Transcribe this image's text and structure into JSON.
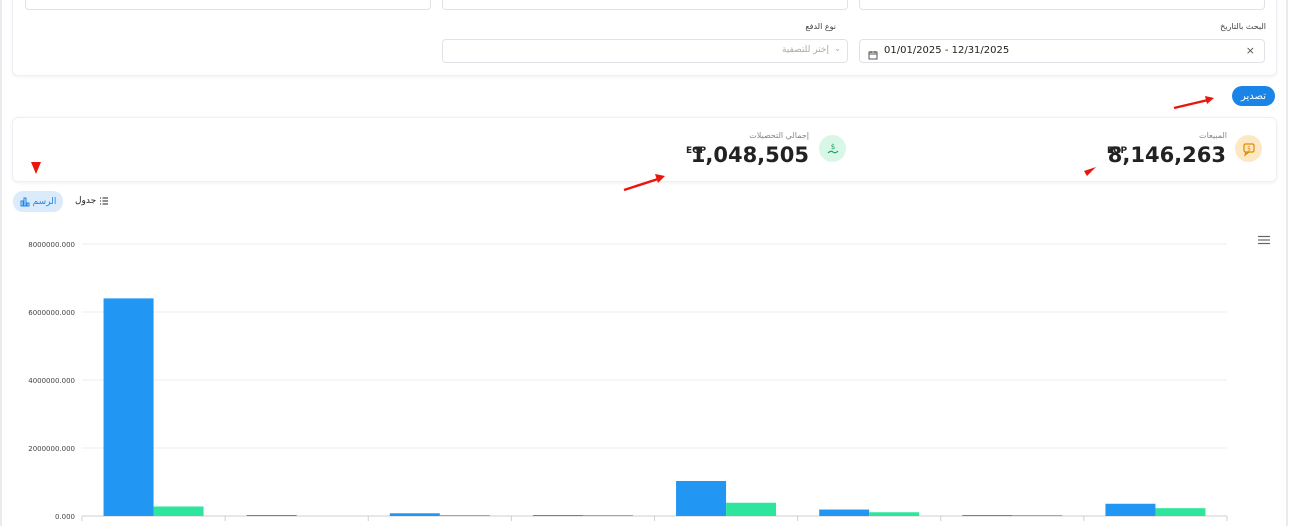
{
  "filters": {
    "date_label": "البحث بالتاريخ",
    "date_value": "01/01/2025 - 12/31/2025",
    "payment_label": "نوع الدفع",
    "payment_placeholder": "إختر للتصفية"
  },
  "export_label": "تصدير",
  "kpis": {
    "sales_label": "المبيعات",
    "sales_value": "8,146,263",
    "sales_currency": "EGP",
    "collections_label": "إجمالي التحصيلات",
    "collections_value": "1,048,505",
    "collections_currency": "EGP"
  },
  "view_toggle": {
    "chart_label": "الرسم",
    "table_label": "جدول"
  },
  "colors": {
    "series1": "#2196f3",
    "series2": "#2ee59d",
    "accent": "#1b84e7",
    "annotation": "#e8160c"
  },
  "chart_data": {
    "type": "bar",
    "categories": [
      "",
      "",
      "",
      "",
      "",
      "",
      "",
      ""
    ],
    "series": [
      {
        "values": [
          6400000,
          20000,
          80000,
          15000,
          1030000,
          190000,
          25000,
          360000
        ]
      },
      {
        "values": [
          280000,
          0,
          20000,
          8000,
          390000,
          110000,
          10000,
          230000
        ]
      }
    ],
    "yticks": [
      "0.000",
      "2000000.000",
      "4000000.000",
      "6000000.000",
      "8000000.000"
    ],
    "ylim": [
      0,
      8000000
    ],
    "grid": true
  }
}
